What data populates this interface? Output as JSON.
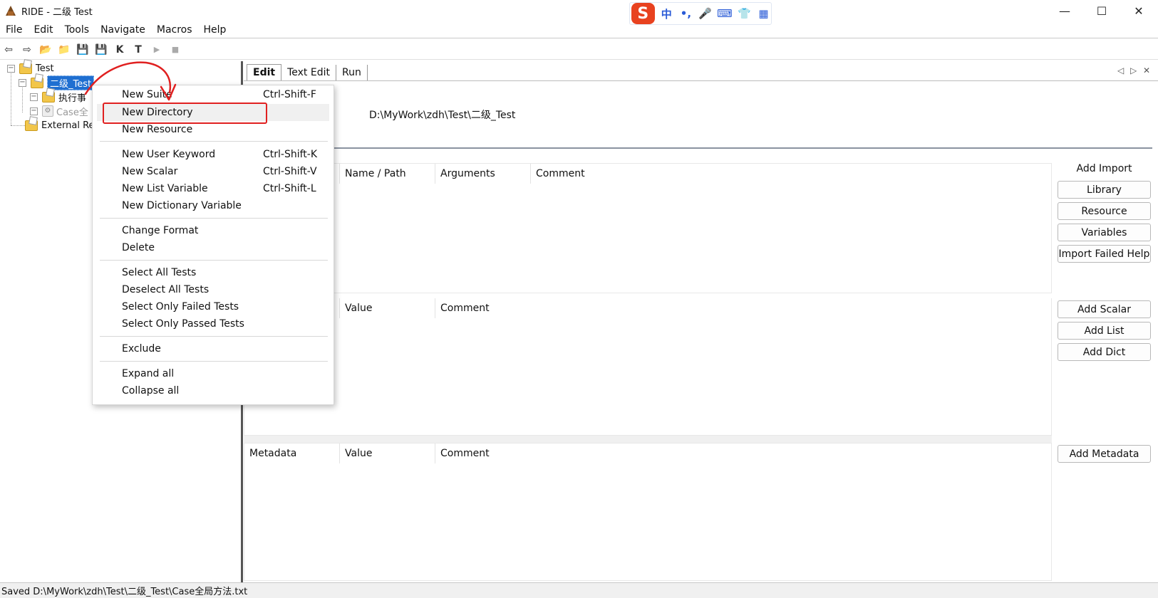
{
  "window": {
    "title": "RIDE - 二级 Test",
    "minimize": "—",
    "maximize": "☐",
    "close": "✕"
  },
  "ime": {
    "logo": "S",
    "mode": "中",
    "punct": "•,",
    "mic": "🎤",
    "keyboard": "⌨",
    "skin": "👕",
    "grid": "▦"
  },
  "menubar": [
    "File",
    "Edit",
    "Tools",
    "Navigate",
    "Macros",
    "Help"
  ],
  "toolbar": {
    "icons": [
      "back-arrow-icon",
      "forward-arrow-icon",
      "open-dir-icon",
      "open-folder-icon",
      "save-icon",
      "save-all-icon",
      "keyword-search-icon",
      "test-search-icon",
      "run-icon",
      "stop-icon"
    ],
    "glyphs": [
      "⇦",
      "⇨",
      "📂",
      "📁",
      "💾",
      "💾",
      "K",
      "T",
      "▶",
      "■"
    ]
  },
  "tree": {
    "root": "Test",
    "child_selected": "二级_Test",
    "child_1": "执行事",
    "child_2": "Case全",
    "external": "External Re"
  },
  "tabs": [
    "Edit",
    "Text Edit",
    "Run"
  ],
  "tab_nav": {
    "left": "◁",
    "right": "▷",
    "close": "✕"
  },
  "source_path": "D:\\MyWork\\zdh\\Test\\二级_Test",
  "imports_table": {
    "columns": [
      "",
      "Name / Path",
      "Arguments",
      "Comment"
    ]
  },
  "variables_table": {
    "columns": [
      "",
      "Value",
      "Comment"
    ]
  },
  "metadata_table": {
    "columns": [
      "Metadata",
      "Value",
      "Comment"
    ]
  },
  "side_buttons": {
    "add_import_label": "Add Import",
    "library": "Library",
    "resource": "Resource",
    "variables": "Variables",
    "import_failed_help": "Import Failed Help",
    "add_scalar": "Add Scalar",
    "add_list": "Add List",
    "add_dict": "Add Dict",
    "add_metadata": "Add Metadata"
  },
  "context_menu": {
    "new_suite": {
      "label": "New Suite",
      "shortcut": "Ctrl-Shift-F"
    },
    "new_directory": {
      "label": "New Directory",
      "shortcut": ""
    },
    "new_resource": {
      "label": "New Resource",
      "shortcut": ""
    },
    "new_user_keyword": {
      "label": "New User Keyword",
      "shortcut": "Ctrl-Shift-K"
    },
    "new_scalar": {
      "label": "New Scalar",
      "shortcut": "Ctrl-Shift-V"
    },
    "new_list_variable": {
      "label": "New List Variable",
      "shortcut": "Ctrl-Shift-L"
    },
    "new_dictionary_variable": {
      "label": "New Dictionary Variable",
      "shortcut": ""
    },
    "change_format": {
      "label": "Change Format"
    },
    "delete": {
      "label": "Delete"
    },
    "select_all_tests": {
      "label": "Select All Tests"
    },
    "deselect_all_tests": {
      "label": "Deselect All Tests"
    },
    "select_only_failed": {
      "label": "Select Only Failed Tests"
    },
    "select_only_passed": {
      "label": "Select Only Passed Tests"
    },
    "exclude": {
      "label": "Exclude"
    },
    "expand_all": {
      "label": "Expand all"
    },
    "collapse_all": {
      "label": "Collapse all"
    }
  },
  "status": "Saved D:\\MyWork\\zdh\\Test\\二级_Test\\Case全局方法.txt",
  "colors": {
    "selection": "#1f6fd1",
    "annotation": "#e02020",
    "ime_brand": "#e8421f"
  }
}
